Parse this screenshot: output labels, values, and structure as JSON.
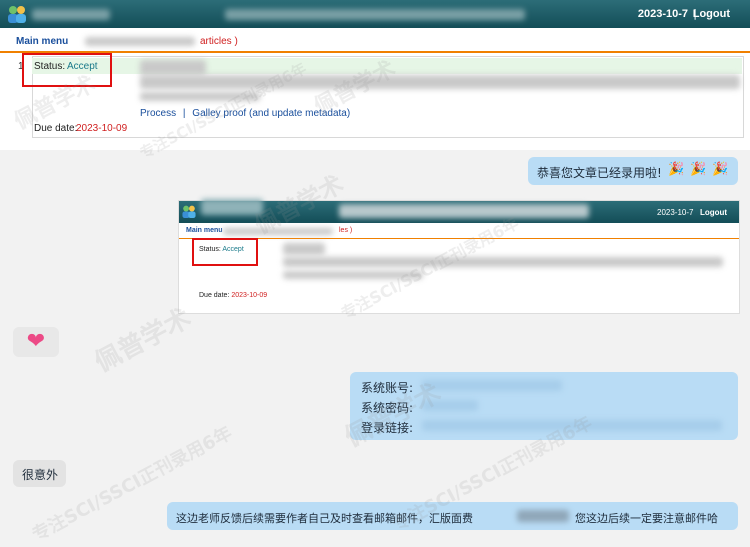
{
  "system": {
    "date": "2023-10-7",
    "separator": "|",
    "logout": "Logout",
    "main_menu": "Main menu",
    "articles": "articles )",
    "row_number": "1",
    "status_label": "Status:",
    "status_value": "Accept",
    "process_link": "Process",
    "link_separator": "|",
    "galley_link": "Galley proof (and update metadata)",
    "due_label": "Due date:",
    "due_value": "2023-10-09"
  },
  "messages": {
    "congrats": "恭喜您文章已经录用啦!",
    "congrats_emoji": "🎉",
    "mini_articles": "les )",
    "heart": "❤",
    "account_label": "系统账号:",
    "password_label": "系统密码:",
    "login_label": "登录链接:",
    "surprise": "很意外",
    "notice_part1": "这边老师反馈后续需要作者自己及时查看邮箱邮件，汇版面费",
    "notice_part2": "您这边后续一定要注意邮件哈"
  },
  "watermark": {
    "brand": "佩普学术",
    "slogan": "专注SCI/SSCI正刊录用6年"
  },
  "colors": {
    "topbar": "#1e5c66",
    "accent_orange": "#f08000",
    "highlight_red": "#e01010",
    "bubble_blue": "#b9dcf5",
    "bubble_gray": "#e3e3e3"
  }
}
